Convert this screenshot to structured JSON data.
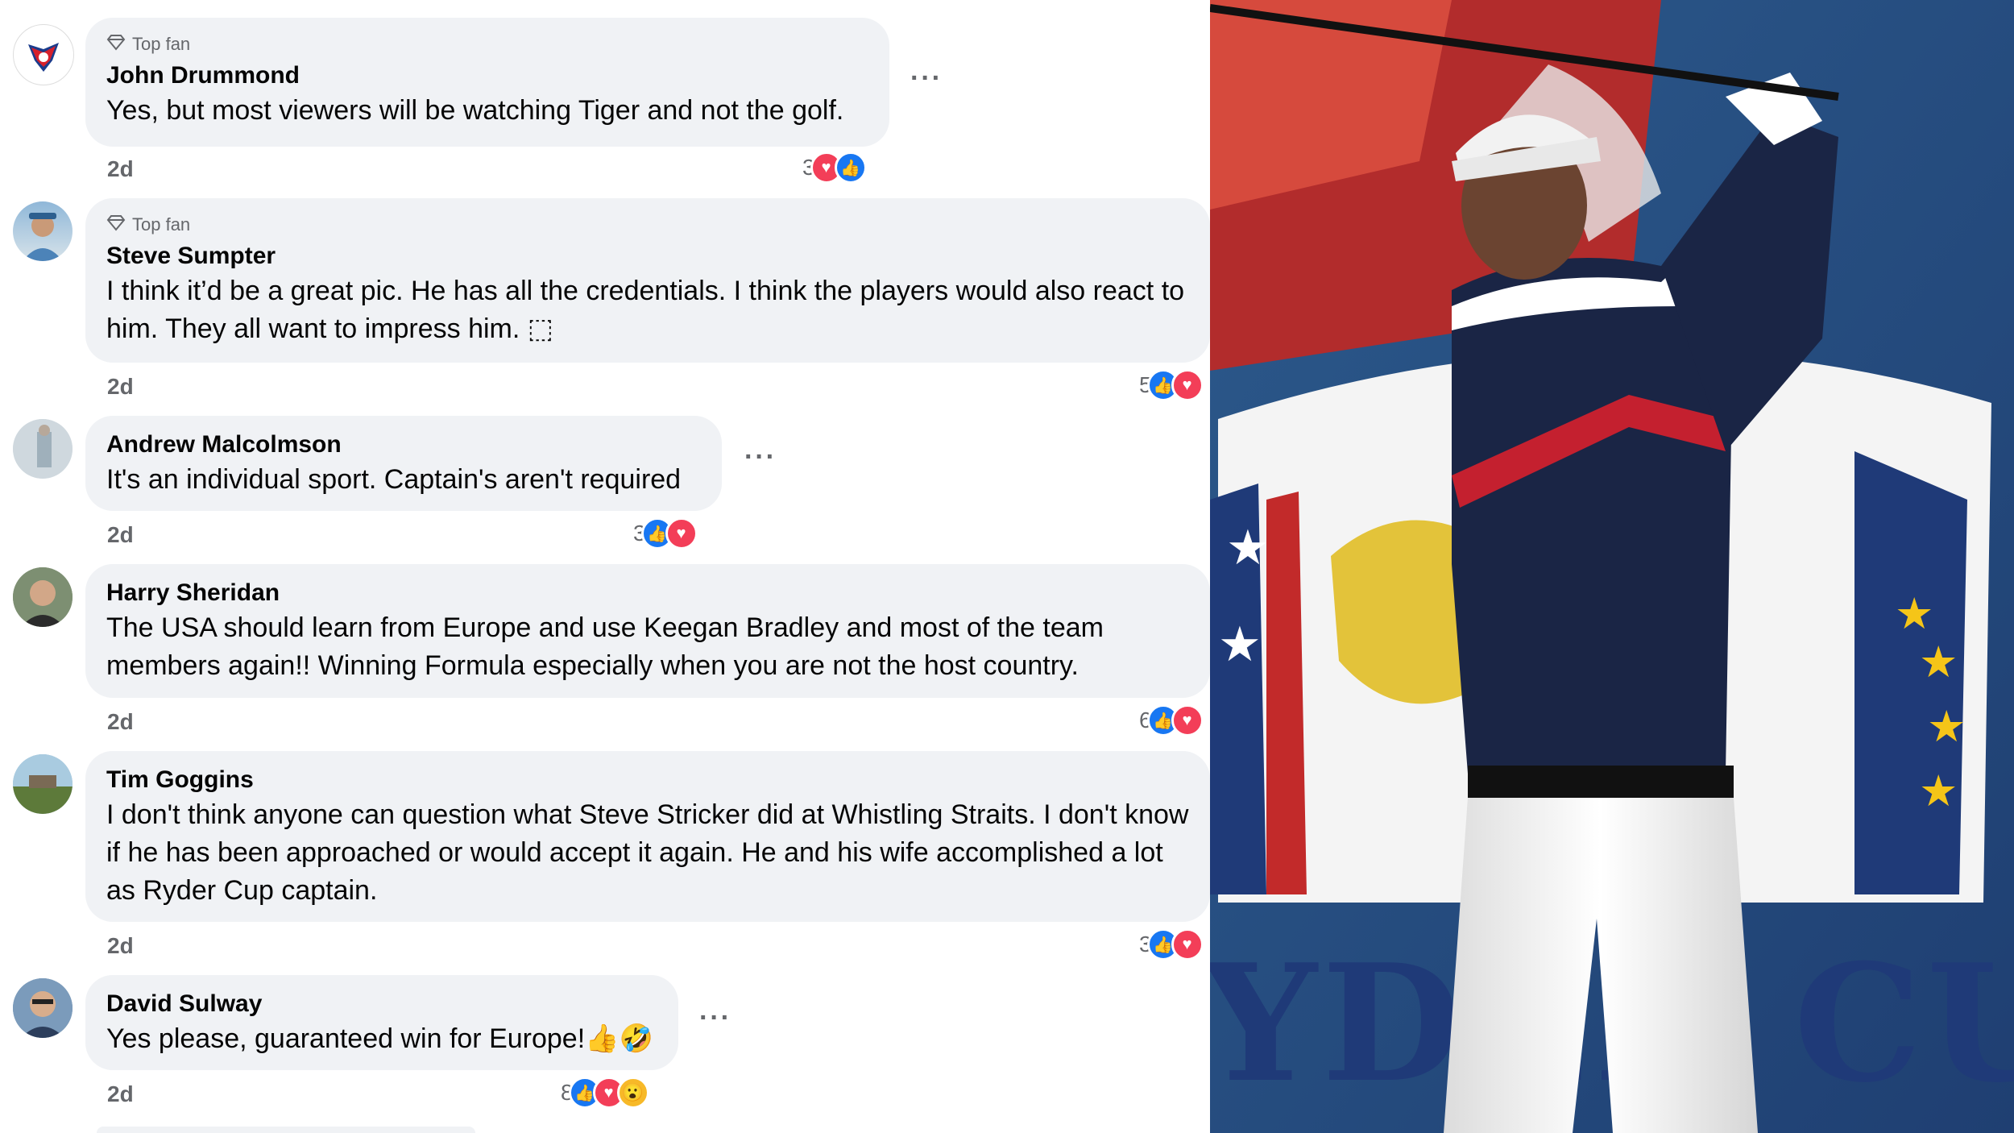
{
  "comments": [
    {
      "badge": "Top fan",
      "name": "John Drummond",
      "text": "Yes, but most viewers will be watching Tiger and not the golf.",
      "time": "2d",
      "reaction_count": "3",
      "reaction_icons": [
        "love-icon",
        "like-icon"
      ],
      "more": "···"
    },
    {
      "badge": "Top fan",
      "name": "Steve Sumpter",
      "text": "I think it’d be a great pic. He has all the credentials. I think the players would also react to him. They all want to impress him. ⬚",
      "time": "2d",
      "reaction_count": "5",
      "reaction_icons": [
        "like-icon",
        "love-icon"
      ]
    },
    {
      "name": "Andrew Malcolmson",
      "text": "It's an individual sport. Captain's aren't required",
      "time": "2d",
      "reaction_count": "3",
      "reaction_icons": [
        "like-icon",
        "love-icon"
      ],
      "more": "···"
    },
    {
      "name": "Harry Sheridan",
      "text": "The USA should learn from Europe and use Keegan Bradley and most of the team members again!! Winning Formula especially when you are not the host country.",
      "time": "2d",
      "reaction_count": "6",
      "reaction_icons": [
        "like-icon",
        "love-icon"
      ]
    },
    {
      "name": "Tim Goggins",
      "text": "I don't think anyone can question what Steve Stricker did at Whistling Straits. I don't know if he has been approached or would accept it again. He and his wife accomplished a lot as Ryder Cup captain.",
      "time": "2d",
      "reaction_count": "3",
      "reaction_icons": [
        "like-icon",
        "love-icon"
      ]
    },
    {
      "name": "David Sulway",
      "text": "Yes please, guaranteed win for Europe!👍🤣",
      "time": "2d",
      "reaction_count": "8",
      "reaction_icons": [
        "like-icon",
        "love-icon",
        "wow-icon"
      ],
      "more": "···"
    }
  ],
  "photo": {
    "banner_text": "YDER CUP"
  },
  "colors": {
    "bubble": "#f0f2f5",
    "meta": "#65676b",
    "like": "#1877f2",
    "love": "#f33e58",
    "wow": "#f7b928"
  }
}
